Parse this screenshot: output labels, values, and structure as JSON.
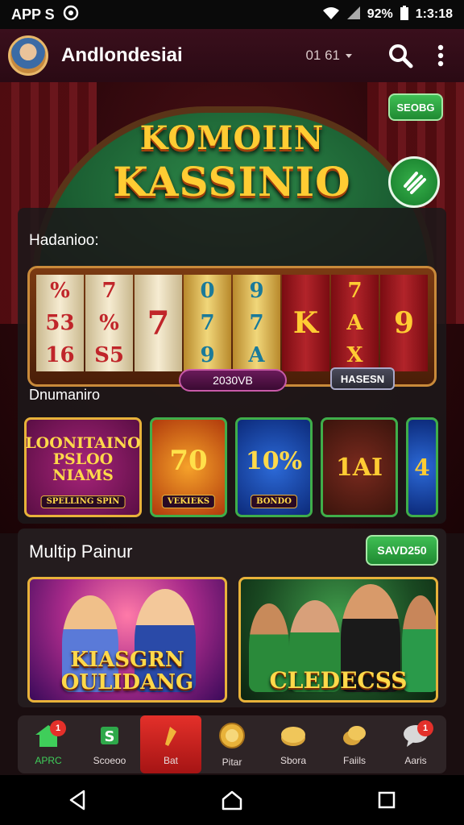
{
  "status_bar": {
    "left_text": "APP S",
    "battery": "92%",
    "time": "1:3:18"
  },
  "app_bar": {
    "title": "Andlondesiai",
    "code": "01 61"
  },
  "hero": {
    "logo_line1": "KOMOIIN",
    "logo_line2": "KASSINIO",
    "badge": "SEOBG"
  },
  "sections": {
    "section1_label": "Hadanioo:",
    "slot_counter": "2030VB",
    "slot_button": "HASESN",
    "section2_label": "Dnumaniro",
    "multiplayer_title": "Multip Painur",
    "multiplayer_badge": "SAVD250"
  },
  "reels": [
    [
      "%",
      "53",
      "16"
    ],
    [
      "7",
      "%",
      "S5"
    ],
    [
      "7",
      "",
      ""
    ],
    [
      "0",
      "7",
      "9"
    ],
    [
      "9",
      "7",
      "A"
    ],
    [
      "",
      "K",
      ""
    ],
    [
      "7",
      "A",
      "X"
    ],
    [
      "",
      "9",
      ""
    ]
  ],
  "cards": [
    {
      "title": "LOONITAINO PSLOO NIAMS",
      "tag": "SPELLING SPIN"
    },
    {
      "title": "70",
      "tag": "VEKIEKS"
    },
    {
      "title": "10%",
      "tag": "BONDO"
    },
    {
      "title": "1AI",
      "tag": ""
    },
    {
      "title": "4",
      "tag": ""
    }
  ],
  "promos": [
    {
      "title": "KIASGRN OULIDANG"
    },
    {
      "title": "CLEDECSS"
    }
  ],
  "bottom_nav": [
    {
      "label": "APRC",
      "icon": "home-icon",
      "badge": "1"
    },
    {
      "label": "Scoeoo",
      "icon": "slot-icon",
      "badge": ""
    },
    {
      "label": "Bat",
      "icon": "bet-icon",
      "badge": ""
    },
    {
      "label": "Pitar",
      "icon": "coin-icon",
      "badge": ""
    },
    {
      "label": "Sbora",
      "icon": "chips-icon",
      "badge": ""
    },
    {
      "label": "Faiils",
      "icon": "gold-coins-icon",
      "badge": ""
    },
    {
      "label": "Aaris",
      "icon": "chat-icon",
      "badge": "1"
    }
  ],
  "colors": {
    "accent_green": "#3fbf54",
    "accent_red": "#e4302a",
    "gold": "#ffcc33",
    "background": "#1a0e10"
  }
}
